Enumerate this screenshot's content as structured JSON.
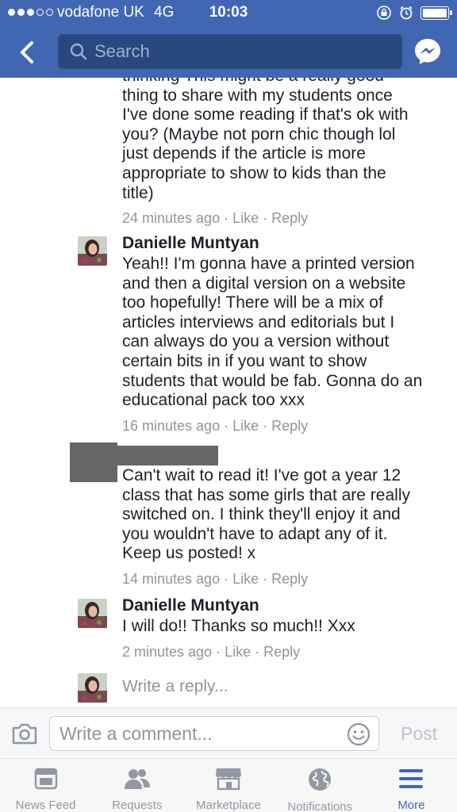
{
  "status_bar": {
    "carrier": "vodafone UK",
    "network": "4G",
    "time": "10:03"
  },
  "header": {
    "search_placeholder": "Search",
    "icons": [
      "back-chevron-icon",
      "search-icon",
      "messenger-icon"
    ]
  },
  "comments": [
    {
      "author": "",
      "text_lines": [
        "thinking This might be a really good",
        "thing to share with my students once",
        "I've done some reading if that's ok with",
        "you? (Maybe not porn chic though lol",
        "just depends if the article is more",
        "appropriate to show to kids than the",
        "title)"
      ],
      "time": "24 minutes ago",
      "like": "Like",
      "reply": "Reply"
    },
    {
      "author": "Danielle Muntyan",
      "text_lines": [
        "Yeah!! I'm gonna have a printed version",
        "and then a digital version on a website",
        "too hopefully! There will be a mix of",
        "articles interviews and editorials but I",
        "can always do you a version without",
        "certain bits in if you want to show",
        "students that would be fab. Gonna do an",
        "educational pack too xxx"
      ],
      "time": "16 minutes ago",
      "like": "Like",
      "reply": "Reply"
    },
    {
      "author": "",
      "text_lines": [
        "Can't wait to read it! I've got a year 12",
        "class that has some girls that are really",
        "switched on. I think they'll enjoy it and",
        "you wouldn't have to adapt any of it.",
        "Keep us posted! x"
      ],
      "time": "14 minutes ago",
      "like": "Like",
      "reply": "Reply"
    },
    {
      "author": "Danielle Muntyan",
      "text_lines": [
        "I will do!! Thanks so much!! Xxx"
      ],
      "time": "2 minutes ago",
      "like": "Like",
      "reply": "Reply"
    }
  ],
  "reply_box": {
    "placeholder": "Write a reply..."
  },
  "composer": {
    "placeholder": "Write a comment...",
    "post_label": "Post"
  },
  "tabs": [
    {
      "label": "News Feed",
      "icon": "news-feed-icon",
      "active": false
    },
    {
      "label": "Requests",
      "icon": "friend-requests-icon",
      "active": false
    },
    {
      "label": "Marketplace",
      "icon": "marketplace-icon",
      "active": false
    },
    {
      "label": "Notifications",
      "icon": "globe-icon",
      "active": false
    },
    {
      "label": "More",
      "icon": "hamburger-menu-icon",
      "active": true
    }
  ],
  "colors": {
    "brand_blue": "#4267b2",
    "search_bg": "#29487d",
    "meta_gray": "#90949c"
  }
}
